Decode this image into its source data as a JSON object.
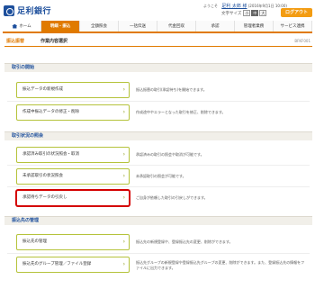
{
  "header": {
    "logo_text": "足利銀行",
    "user_info_prefix": "ようこそ",
    "user_name": "足利 太郎 様",
    "user_info_suffix": "(2016年9月1日 10:00)",
    "font_size_label": "文字サイズ",
    "font_sizes": [
      "小",
      "中",
      "大"
    ],
    "logout_label": "ログアウト"
  },
  "gnav": {
    "items": [
      "ホーム",
      "明細・振込",
      "全額照会",
      "一括伝送",
      "代金回収",
      "承認",
      "管理者業務",
      "サービス連携"
    ]
  },
  "breadcrumb": {
    "main": "振込振替",
    "sub": "作業内容選択",
    "screen_id": "BFKF001"
  },
  "sections": [
    {
      "title": "取引の開始",
      "items": [
        {
          "label": "振込データの新規作成",
          "desc": "振込振替の取引(承認待ち)を開始できます。"
        },
        {
          "label": "作成中振込データの修正・削除",
          "desc": "作成途中やエラーとなった取引を修正、削除できます。"
        }
      ]
    },
    {
      "title": "取引状況の照会",
      "items": [
        {
          "label": "承認済み取引の状況照会・取消",
          "desc": "承認済みの取引の照会や取消が可能です。"
        },
        {
          "label": "未承認取引の状況照会",
          "desc": "未承認取引の照会が可能です。"
        },
        {
          "label": "承認待ちデータの引戻し",
          "desc": "ご自身が依頼した取引の引戻しができます。"
        }
      ]
    },
    {
      "title": "振込先の管理",
      "items": [
        {
          "label": "振込先の管理",
          "desc": "振込先の新規登録や、登録振込先の変更、削除ができます。"
        },
        {
          "label": "振込先のグループ管理／ファイル登録",
          "desc": "振込先グループの新規登録や登録振込先グループの変更、削除ができます。また、登録振込先の情報をファイルに出力できます。"
        }
      ]
    }
  ],
  "icons": {
    "chevron": "chevron-right-icon",
    "home": "home-icon"
  },
  "colors": {
    "accent": "#e07a00",
    "brand": "#1d4f9c",
    "button_border": "#b5c33b",
    "highlight": "#d40000"
  }
}
